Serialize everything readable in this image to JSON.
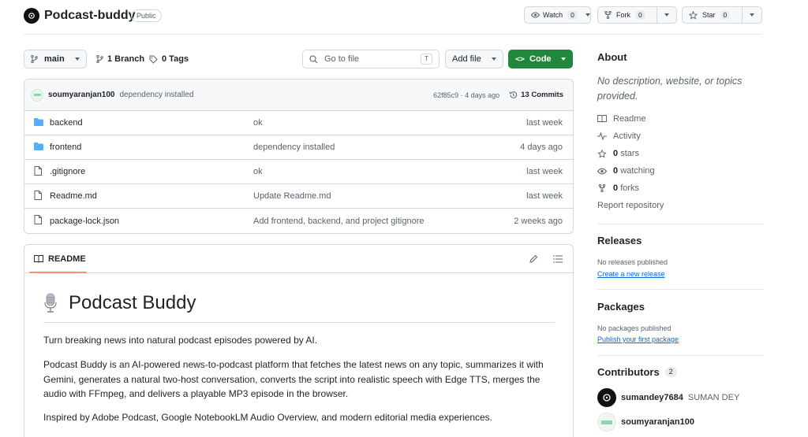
{
  "repo": {
    "name": "Podcast-buddy",
    "visibility": "Public"
  },
  "actions": {
    "watch_label": "Watch",
    "watch_count": "0",
    "fork_label": "Fork",
    "fork_count": "0",
    "star_label": "Star",
    "star_count": "0"
  },
  "toolbar": {
    "branch": "main",
    "branches": "1 Branch",
    "tags": "0 Tags",
    "search_placeholder": "Go to file",
    "search_kbd": "T",
    "add_file": "Add file",
    "code": "Code"
  },
  "commit": {
    "author": "soumyaranjan100",
    "message": "dependency installed",
    "hash_time": "62f85c9 · 4 days ago",
    "commits": "13 Commits"
  },
  "files": [
    {
      "type": "folder",
      "name": "backend",
      "message": "ok",
      "date": "last week"
    },
    {
      "type": "folder",
      "name": "frontend",
      "message": "dependency installed",
      "date": "4 days ago"
    },
    {
      "type": "file",
      "name": ".gitignore",
      "message": "ok",
      "date": "last week"
    },
    {
      "type": "file",
      "name": "Readme.md",
      "message": "Update Readme.md",
      "date": "last week"
    },
    {
      "type": "file",
      "name": "package-lock.json",
      "message": "Add frontend, backend, and project gitignore",
      "date": "2 weeks ago"
    }
  ],
  "readme": {
    "tab": "README",
    "title": "Podcast Buddy",
    "p1": "Turn breaking news into natural podcast episodes powered by AI.",
    "p2": "Podcast Buddy is an AI-powered news-to-podcast platform that fetches the latest news on any topic, summarizes it with Gemini, generates a natural two-host conversation, converts the script into realistic speech with Edge TTS, merges the audio with FFmpeg, and delivers a playable MP3 episode in the browser.",
    "p3": "Inspired by Adobe Podcast, Google NotebookLM Audio Overview, and modern editorial media experiences."
  },
  "about": {
    "title": "About",
    "description": "No description, website, or topics provided.",
    "readme": "Readme",
    "activity": "Activity",
    "stars_num": "0",
    "stars_label": "stars",
    "watching_num": "0",
    "watching_label": "watching",
    "forks_num": "0",
    "forks_label": "forks",
    "report": "Report repository"
  },
  "releases": {
    "title": "Releases",
    "none": "No releases published",
    "create": "Create a new release"
  },
  "packages": {
    "title": "Packages",
    "none": "No packages published",
    "publish": "Publish your first package"
  },
  "contributors": {
    "title": "Contributors",
    "count": "2",
    "list": [
      {
        "login": "sumandey7684",
        "name": "SUMAN DEY"
      },
      {
        "login": "soumyaranjan100",
        "name": ""
      }
    ]
  },
  "colors": {
    "accent_green": "#1f883d",
    "link_blue": "#0969da",
    "folder_blue": "#54aeff",
    "tab_underline": "#fd8c73"
  }
}
